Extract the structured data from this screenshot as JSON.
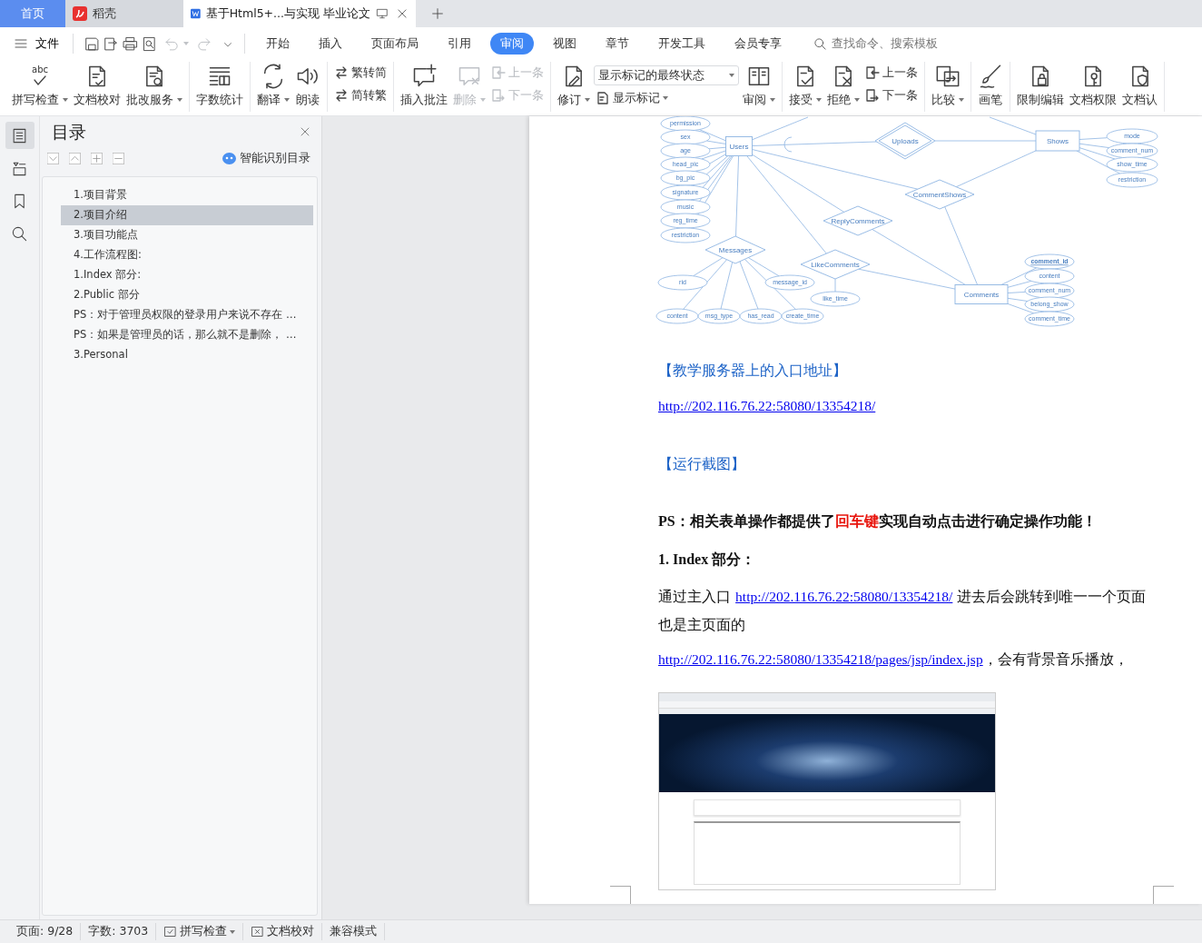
{
  "tabs": [
    {
      "label": "首页",
      "kind": "home",
      "selected": false
    },
    {
      "label": "稻壳",
      "kind": "docer",
      "selected": false
    },
    {
      "label": "基于Html5+...与实现 毕业论文",
      "kind": "document",
      "selected": true
    }
  ],
  "menu": {
    "file_label": "文件",
    "undo_disabled": true,
    "redo_disabled": true,
    "tabs": [
      {
        "label": "开始",
        "selected": false
      },
      {
        "label": "插入",
        "selected": false
      },
      {
        "label": "页面布局",
        "selected": false
      },
      {
        "label": "引用",
        "selected": false
      },
      {
        "label": "审阅",
        "selected": true
      },
      {
        "label": "视图",
        "selected": false
      },
      {
        "label": "章节",
        "selected": false
      },
      {
        "label": "开发工具",
        "selected": false
      },
      {
        "label": "会员专享",
        "selected": false
      }
    ],
    "search": {
      "placeholder": "查找命令、搜索模板"
    }
  },
  "ribbon": [
    {
      "items": [
        {
          "kind": "large",
          "label": "拼写检查",
          "icon_text": "abc",
          "dropdown": true,
          "disabled": false
        },
        {
          "kind": "large",
          "label": "文档校对",
          "dropdown": false,
          "disabled": false
        },
        {
          "kind": "large",
          "label": "批改服务",
          "dropdown": true,
          "disabled": false
        }
      ]
    },
    {
      "items": [
        {
          "kind": "large",
          "label": "字数统计",
          "dropdown": false,
          "disabled": false
        }
      ]
    },
    {
      "items": [
        {
          "kind": "large",
          "label": "翻译",
          "dropdown": true,
          "disabled": false
        },
        {
          "kind": "large",
          "label": "朗读",
          "dropdown": false,
          "disabled": false
        }
      ]
    },
    {
      "items": [
        {
          "kind": "stack",
          "buttons": [
            {
              "label": "繁转简",
              "dropdown": false,
              "disabled": false
            },
            {
              "label": "简转繁",
              "dropdown": false,
              "disabled": false
            }
          ]
        }
      ]
    },
    {
      "items": [
        {
          "kind": "large",
          "label": "插入批注",
          "dropdown": false,
          "disabled": false
        },
        {
          "kind": "large",
          "label": "删除",
          "dropdown": true,
          "disabled": true
        },
        {
          "kind": "stack",
          "buttons": [
            {
              "label": "上一条",
              "dropdown": false,
              "disabled": true
            },
            {
              "label": "下一条",
              "dropdown": false,
              "disabled": true
            }
          ]
        }
      ]
    },
    {
      "items": [
        {
          "kind": "large",
          "label": "修订",
          "dropdown": true,
          "disabled": false
        },
        {
          "kind": "select",
          "value": "显示标记的最终状态",
          "button": {
            "label": "显示标记",
            "dropdown": true,
            "disabled": false
          }
        },
        {
          "kind": "large",
          "label": "审阅",
          "dropdown": true,
          "disabled": false
        }
      ]
    },
    {
      "items": [
        {
          "kind": "large",
          "label": "接受",
          "dropdown": true,
          "disabled": false
        },
        {
          "kind": "large",
          "label": "拒绝",
          "dropdown": true,
          "disabled": false
        },
        {
          "kind": "stack",
          "buttons": [
            {
              "label": "上一条",
              "dropdown": false,
              "disabled": false
            },
            {
              "label": "下一条",
              "dropdown": false,
              "disabled": false
            }
          ]
        }
      ]
    },
    {
      "items": [
        {
          "kind": "large",
          "label": "比较",
          "dropdown": true,
          "disabled": false
        }
      ]
    },
    {
      "items": [
        {
          "kind": "large",
          "label": "画笔",
          "dropdown": false,
          "disabled": false
        }
      ]
    },
    {
      "items": [
        {
          "kind": "large",
          "label": "限制编辑",
          "dropdown": false,
          "disabled": false
        },
        {
          "kind": "large",
          "label": "文档权限",
          "dropdown": false,
          "disabled": false
        },
        {
          "kind": "large",
          "label": "文档认",
          "dropdown": false,
          "disabled": false
        }
      ]
    }
  ],
  "nav_rail": [
    {
      "selected": true
    },
    {
      "selected": false
    },
    {
      "selected": false
    },
    {
      "selected": false
    }
  ],
  "outline_panel": {
    "title": "目录",
    "smart_button": "智能识别目录",
    "items": [
      {
        "label": "1.项目背景",
        "selected": false
      },
      {
        "label": "2.项目介绍",
        "selected": true
      },
      {
        "label": "3.项目功能点",
        "selected": false
      },
      {
        "label": "4.工作流程图:",
        "selected": false
      },
      {
        "label": "1.Index 部分:",
        "selected": false
      },
      {
        "label": "2.Public 部分",
        "selected": false
      },
      {
        "label": "PS：对于管理员权限的登录用户来说不存在 …",
        "selected": false
      },
      {
        "label": "PS：如果是管理员的话，那么就不是删除， …",
        "selected": false
      },
      {
        "label": "3.Personal",
        "selected": false
      }
    ]
  },
  "document": {
    "er_diagram": {
      "nodes": [
        {
          "kind": "entity",
          "label": "Users"
        },
        {
          "kind": "entity",
          "label": "Shows"
        },
        {
          "kind": "entity",
          "label": "Comments"
        },
        {
          "kind": "weak_relationship",
          "label": "Uploads"
        },
        {
          "kind": "relationship",
          "label": "CommentShows"
        },
        {
          "kind": "relationship",
          "label": "ReplyComments"
        },
        {
          "kind": "relationship",
          "label": "Messages"
        },
        {
          "kind": "relationship",
          "label": "LikeComments"
        },
        {
          "kind": "attribute",
          "label": "permission"
        },
        {
          "kind": "attribute",
          "label": "sex"
        },
        {
          "kind": "attribute",
          "label": "age"
        },
        {
          "kind": "attribute",
          "label": "head_pic"
        },
        {
          "kind": "attribute",
          "label": "bg_pic"
        },
        {
          "kind": "attribute",
          "label": "signature"
        },
        {
          "kind": "attribute",
          "label": "music"
        },
        {
          "kind": "attribute",
          "label": "reg_time"
        },
        {
          "kind": "attribute",
          "label": "restriction"
        },
        {
          "kind": "attribute",
          "label": "mode"
        },
        {
          "kind": "attribute",
          "label": "comment_num"
        },
        {
          "kind": "attribute",
          "label": "show_time"
        },
        {
          "kind": "attribute",
          "label": "restriction"
        },
        {
          "kind": "attribute",
          "label": "rid"
        },
        {
          "kind": "attribute",
          "label": "message_id"
        },
        {
          "kind": "attribute",
          "label": "content"
        },
        {
          "kind": "attribute",
          "label": "msg_type"
        },
        {
          "kind": "attribute",
          "label": "has_read"
        },
        {
          "kind": "attribute",
          "label": "create_time"
        },
        {
          "kind": "attribute",
          "label": "like_time"
        },
        {
          "kind": "key_attribute",
          "label": "comment_id"
        },
        {
          "kind": "attribute",
          "label": "content"
        },
        {
          "kind": "attribute",
          "label": "comment_num"
        },
        {
          "kind": "attribute",
          "label": "belong_show"
        },
        {
          "kind": "attribute",
          "label": "comment_time"
        }
      ]
    },
    "blocks": [
      {
        "kind": "section_title",
        "runs": [
          {
            "kind": "plain",
            "text": "【教学服务器上的入口地址】"
          }
        ]
      },
      {
        "kind": "paragraph",
        "runs": [
          {
            "kind": "link",
            "text": "http://202.116.76.22:58080/13354218/"
          }
        ]
      },
      {
        "kind": "section_title",
        "runs": [
          {
            "kind": "plain",
            "text": "【运行截图】"
          }
        ]
      },
      {
        "kind": "emphasis",
        "runs": [
          {
            "kind": "plain",
            "text": "PS：相关表单操作都提供了"
          },
          {
            "kind": "red",
            "text": "回车键"
          },
          {
            "kind": "plain",
            "text": "实现自动点击进行确定操作功能！"
          }
        ]
      },
      {
        "kind": "emphasis",
        "runs": [
          {
            "kind": "plain",
            "text": "1. Index 部分："
          }
        ]
      },
      {
        "kind": "paragraph",
        "runs": [
          {
            "kind": "plain",
            "text": "通过主入口 "
          },
          {
            "kind": "link",
            "text": "http://202.116.76.22:58080/13354218/"
          },
          {
            "kind": "plain",
            "text": " 进去后会跳转到唯一一个页面也是主页面的"
          }
        ]
      },
      {
        "kind": "paragraph",
        "runs": [
          {
            "kind": "link",
            "text": "http://202.116.76.22:58080/13354218/pages/jsp/index.jsp"
          },
          {
            "kind": "plain",
            "text": "，会有背景音乐播放，"
          }
        ]
      },
      {
        "kind": "image"
      }
    ]
  },
  "status_bar": [
    {
      "kind": "text",
      "label": "页面: 9/28"
    },
    {
      "kind": "text",
      "label": "字数: 3703"
    },
    {
      "kind": "button",
      "label": "拼写检查",
      "dropdown": true
    },
    {
      "kind": "button",
      "label": "文档校对",
      "dropdown": false
    },
    {
      "kind": "text",
      "label": "兼容模式"
    }
  ]
}
